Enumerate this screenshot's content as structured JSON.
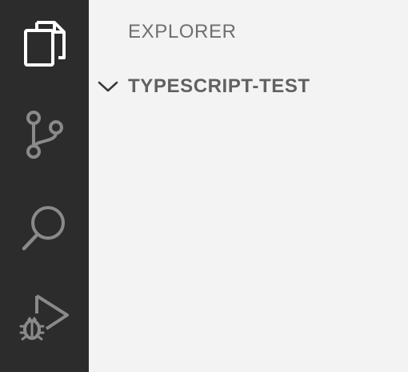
{
  "activity_bar": {
    "items": [
      {
        "name": "explorer",
        "icon": "files-icon",
        "active": true
      },
      {
        "name": "source-control",
        "icon": "source-control-icon",
        "active": false
      },
      {
        "name": "search",
        "icon": "search-icon",
        "active": false
      },
      {
        "name": "run-debug",
        "icon": "run-debug-icon",
        "active": false
      }
    ],
    "background": "#2c2c2c",
    "active_icon_color": "#ffffff",
    "inactive_icon_color": "#8a8a8a"
  },
  "sidebar": {
    "title": "EXPLORER",
    "section": {
      "label": "TYPESCRIPT-TEST",
      "expanded": true,
      "icon": "chevron-down-icon"
    },
    "background": "#f3f3f3"
  }
}
